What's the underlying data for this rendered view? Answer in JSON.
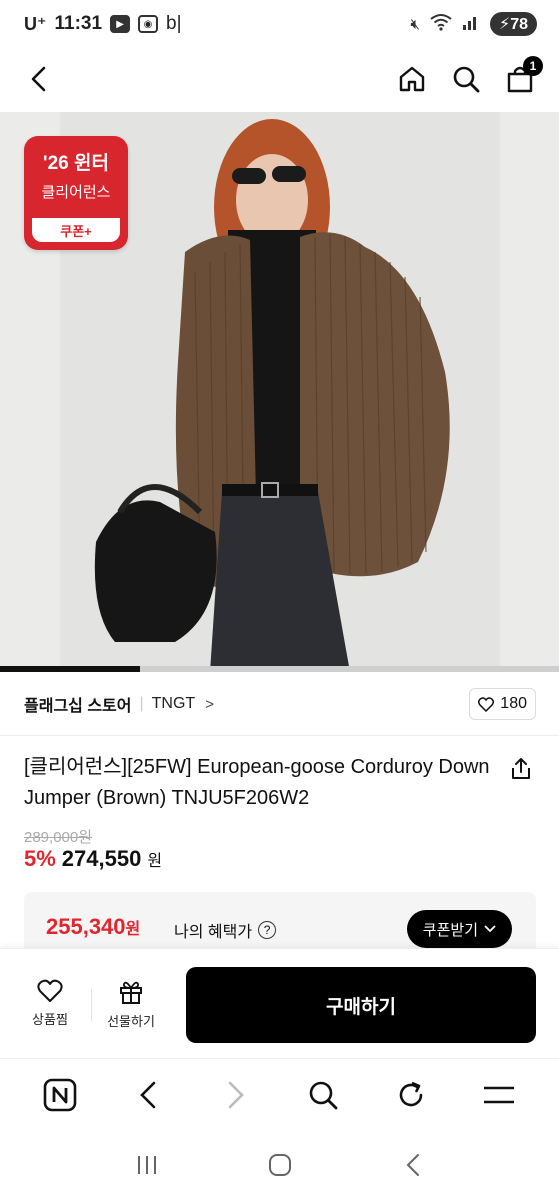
{
  "status_bar": {
    "carrier": "U⁺",
    "time": "11:31",
    "extra": "b|",
    "battery": "78"
  },
  "top_nav": {
    "cart_count": "1"
  },
  "product_image": {
    "coupon_badge": {
      "line1": "'26 윈터",
      "line2": "클리어런스",
      "pill": "쿠폰+"
    },
    "progress_fraction": 0.25
  },
  "store": {
    "store_name": "플래그십 스토어",
    "brand": "TNGT",
    "chevron": ">",
    "likes": "180"
  },
  "product": {
    "title": "[클리어런스][25FW] European-goose Corduroy Down Jumper (Brown) TNJU5F206W2",
    "original_price": "289,000원",
    "discount": "5%",
    "price": "274,550",
    "price_unit": "원"
  },
  "benefit": {
    "price": "255,340",
    "price_unit": "원",
    "label": "나의 혜택가",
    "coupon_button": "쿠폰받기"
  },
  "action_bar": {
    "wish_label": "상품찜",
    "gift_label": "선물하기",
    "buy_label": "구매하기"
  },
  "colors": {
    "accent_red": "#e0262f",
    "badge_red": "#d7262e",
    "black": "#000000"
  }
}
